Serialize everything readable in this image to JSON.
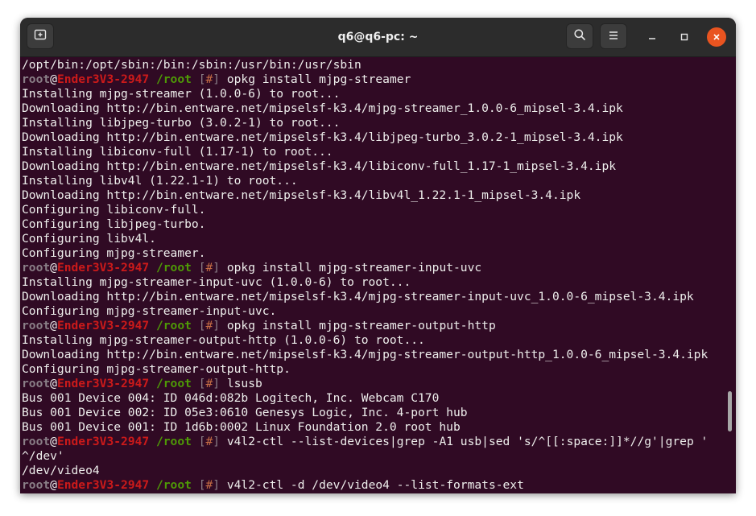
{
  "window": {
    "title": "q6@q6-pc: ~",
    "icons": {
      "new_tab": "new-tab-icon",
      "search": "search-icon",
      "menu": "hamburger-menu-icon",
      "minimize": "minimize-icon",
      "maximize": "maximize-icon",
      "close": "close-icon"
    },
    "colors": {
      "terminal_bg": "#300a24",
      "titlebar_bg": "#2c2c2c",
      "close_button": "#e95420",
      "prompt_user": "#8a7f87",
      "prompt_host": "#cc1a1a",
      "prompt_path": "#4e9a06",
      "text": "#eeeeec"
    }
  },
  "prompt": {
    "user": "root",
    "at": "@",
    "host": "Ender3V3-2947",
    "path": " /root",
    "open": " [",
    "hash": "#",
    "close": "] "
  },
  "terminal": {
    "lines": [
      {
        "type": "out",
        "text": "/opt/bin:/opt/sbin:/bin:/sbin:/usr/bin:/usr/sbin"
      },
      {
        "type": "cmd",
        "text": "opkg install mjpg-streamer"
      },
      {
        "type": "out",
        "text": "Installing mjpg-streamer (1.0.0-6) to root..."
      },
      {
        "type": "out",
        "text": "Downloading http://bin.entware.net/mipselsf-k3.4/mjpg-streamer_1.0.0-6_mipsel-3.4.ipk"
      },
      {
        "type": "out",
        "text": "Installing libjpeg-turbo (3.0.2-1) to root..."
      },
      {
        "type": "out",
        "text": "Downloading http://bin.entware.net/mipselsf-k3.4/libjpeg-turbo_3.0.2-1_mipsel-3.4.ipk"
      },
      {
        "type": "out",
        "text": "Installing libiconv-full (1.17-1) to root..."
      },
      {
        "type": "out",
        "text": "Downloading http://bin.entware.net/mipselsf-k3.4/libiconv-full_1.17-1_mipsel-3.4.ipk"
      },
      {
        "type": "out",
        "text": "Installing libv4l (1.22.1-1) to root..."
      },
      {
        "type": "out",
        "text": "Downloading http://bin.entware.net/mipselsf-k3.4/libv4l_1.22.1-1_mipsel-3.4.ipk"
      },
      {
        "type": "out",
        "text": "Configuring libiconv-full."
      },
      {
        "type": "out",
        "text": "Configuring libjpeg-turbo."
      },
      {
        "type": "out",
        "text": "Configuring libv4l."
      },
      {
        "type": "out",
        "text": "Configuring mjpg-streamer."
      },
      {
        "type": "cmd",
        "text": "opkg install mjpg-streamer-input-uvc"
      },
      {
        "type": "out",
        "text": "Installing mjpg-streamer-input-uvc (1.0.0-6) to root..."
      },
      {
        "type": "out",
        "text": "Downloading http://bin.entware.net/mipselsf-k3.4/mjpg-streamer-input-uvc_1.0.0-6_mipsel-3.4.ipk"
      },
      {
        "type": "out",
        "text": "Configuring mjpg-streamer-input-uvc."
      },
      {
        "type": "cmd",
        "text": "opkg install mjpg-streamer-output-http"
      },
      {
        "type": "out",
        "text": "Installing mjpg-streamer-output-http (1.0.0-6) to root..."
      },
      {
        "type": "out",
        "text": "Downloading http://bin.entware.net/mipselsf-k3.4/mjpg-streamer-output-http_1.0.0-6_mipsel-3.4.ipk"
      },
      {
        "type": "out",
        "text": "Configuring mjpg-streamer-output-http."
      },
      {
        "type": "cmd",
        "text": "lsusb"
      },
      {
        "type": "out",
        "text": "Bus 001 Device 004: ID 046d:082b Logitech, Inc. Webcam C170"
      },
      {
        "type": "out",
        "text": "Bus 001 Device 002: ID 05e3:0610 Genesys Logic, Inc. 4-port hub"
      },
      {
        "type": "out",
        "text": "Bus 001 Device 001: ID 1d6b:0002 Linux Foundation 2.0 root hub"
      },
      {
        "type": "cmd",
        "text": "v4l2-ctl --list-devices|grep -A1 usb|sed 's/^[[:space:]]*//g'|grep '"
      },
      {
        "type": "out",
        "text": "^/dev'"
      },
      {
        "type": "out",
        "text": "/dev/video4"
      },
      {
        "type": "cmd",
        "text": "v4l2-ctl -d /dev/video4 --list-formats-ext"
      }
    ]
  }
}
